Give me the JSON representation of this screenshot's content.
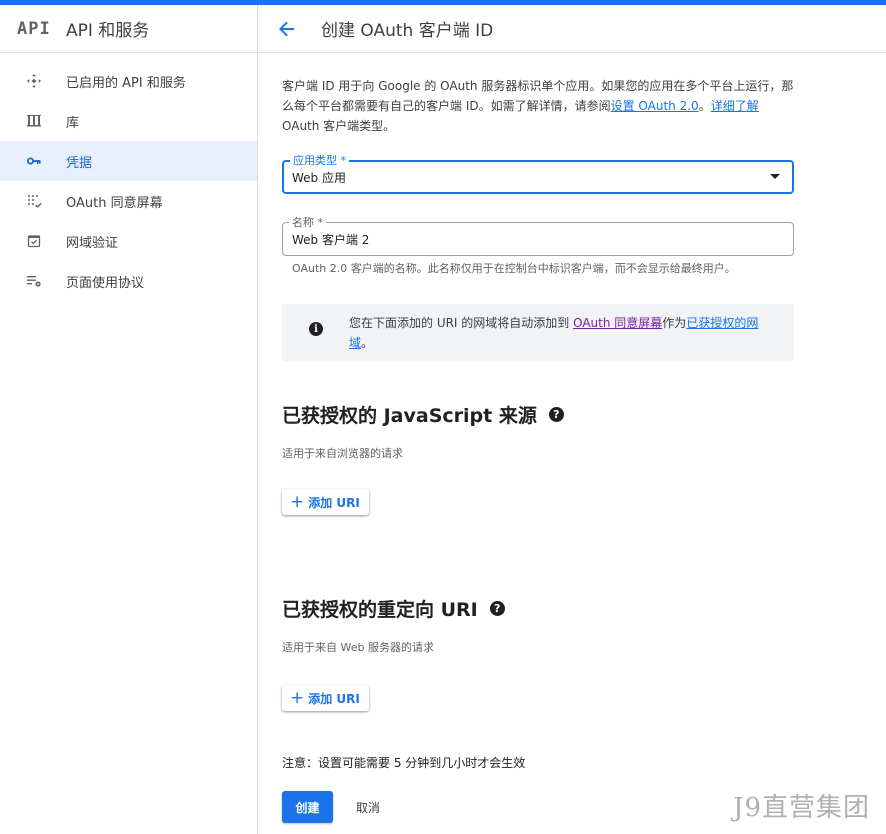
{
  "sidebar": {
    "logo_text": "API",
    "title": "API 和服务",
    "items": [
      {
        "label": "已启用的 API 和服务",
        "icon": "apis-icon",
        "active": false
      },
      {
        "label": "库",
        "icon": "library-icon",
        "active": false
      },
      {
        "label": "凭据",
        "icon": "key-icon",
        "active": true
      },
      {
        "label": "OAuth 同意屏幕",
        "icon": "consent-screen-icon",
        "active": false
      },
      {
        "label": "网域验证",
        "icon": "domain-verification-icon",
        "active": false
      },
      {
        "label": "页面使用协议",
        "icon": "page-usage-settings-icon",
        "active": false
      }
    ]
  },
  "header": {
    "back_icon": "arrow-back-icon",
    "title": "创建 OAuth 客户端 ID"
  },
  "intro": {
    "text": "客户端 ID 用于向 Google 的 OAuth 服务器标识单个应用。如果您的应用在多个平台上运行，那么每个平台都需要有自己的客户端 ID。如需了解详情，请参阅",
    "link1": "设置 OAuth 2.0",
    "sep": "。",
    "link2": "详细了解",
    "tail": " OAuth 客户端类型。"
  },
  "app_type": {
    "label": "应用类型 *",
    "value": "Web 应用"
  },
  "name_field": {
    "label": "名称 *",
    "value": "Web 客户端 2",
    "hint": "OAuth 2.0 客户端的名称。此名称仅用于在控制台中标识客户端，而不会显示给最终用户。"
  },
  "info": {
    "text_before": "您在下面添加的 URI 的网域将自动添加到 ",
    "link1": "OAuth 同意屏幕",
    "text_mid": "作为",
    "link2": "已获授权的网域",
    "text_after": "。"
  },
  "js_origins": {
    "title": "已获授权的 JavaScript 来源",
    "subtitle": "适用于来自浏览器的请求",
    "add_label": "添加 URI"
  },
  "redirect_uris": {
    "title": "已获授权的重定向 URI",
    "subtitle": "适用于来自 Web 服务器的请求",
    "add_label": "添加 URI"
  },
  "note": "注意：设置可能需要 5 分钟到几小时才会生效",
  "actions": {
    "create": "创建",
    "cancel": "取消"
  },
  "watermark": "J9直营集团",
  "colors": {
    "accent": "#1a73e8",
    "active_bg": "#e8f0fe",
    "info_bg": "#f1f3f4"
  }
}
